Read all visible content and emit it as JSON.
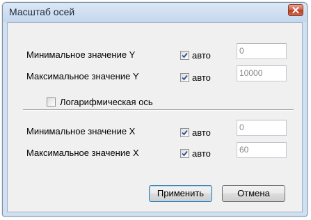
{
  "window": {
    "title": "Масштаб осей"
  },
  "icons": {
    "close": "close-icon",
    "check": "checkmark-icon"
  },
  "y_axis": {
    "min_label": "Минимальное значение Y",
    "min_auto_label": "авто",
    "min_auto_checked": true,
    "min_value": "0",
    "max_label": "Максимальное значение Y",
    "max_auto_label": "авто",
    "max_auto_checked": true,
    "max_value": "10000",
    "log_label": "Логарифмическая ось",
    "log_checked": false
  },
  "x_axis": {
    "min_label": "Минимальное значение X",
    "min_auto_label": "авто",
    "min_auto_checked": true,
    "min_value": "0",
    "max_label": "Максимальное значение X",
    "max_auto_label": "авто",
    "max_auto_checked": true,
    "max_value": "60"
  },
  "buttons": {
    "apply": "Применить",
    "cancel": "Отмена"
  },
  "colors": {
    "check": "#2a4f8f",
    "close_button": "#cf5b40",
    "field_text": "#8a8a8a"
  }
}
